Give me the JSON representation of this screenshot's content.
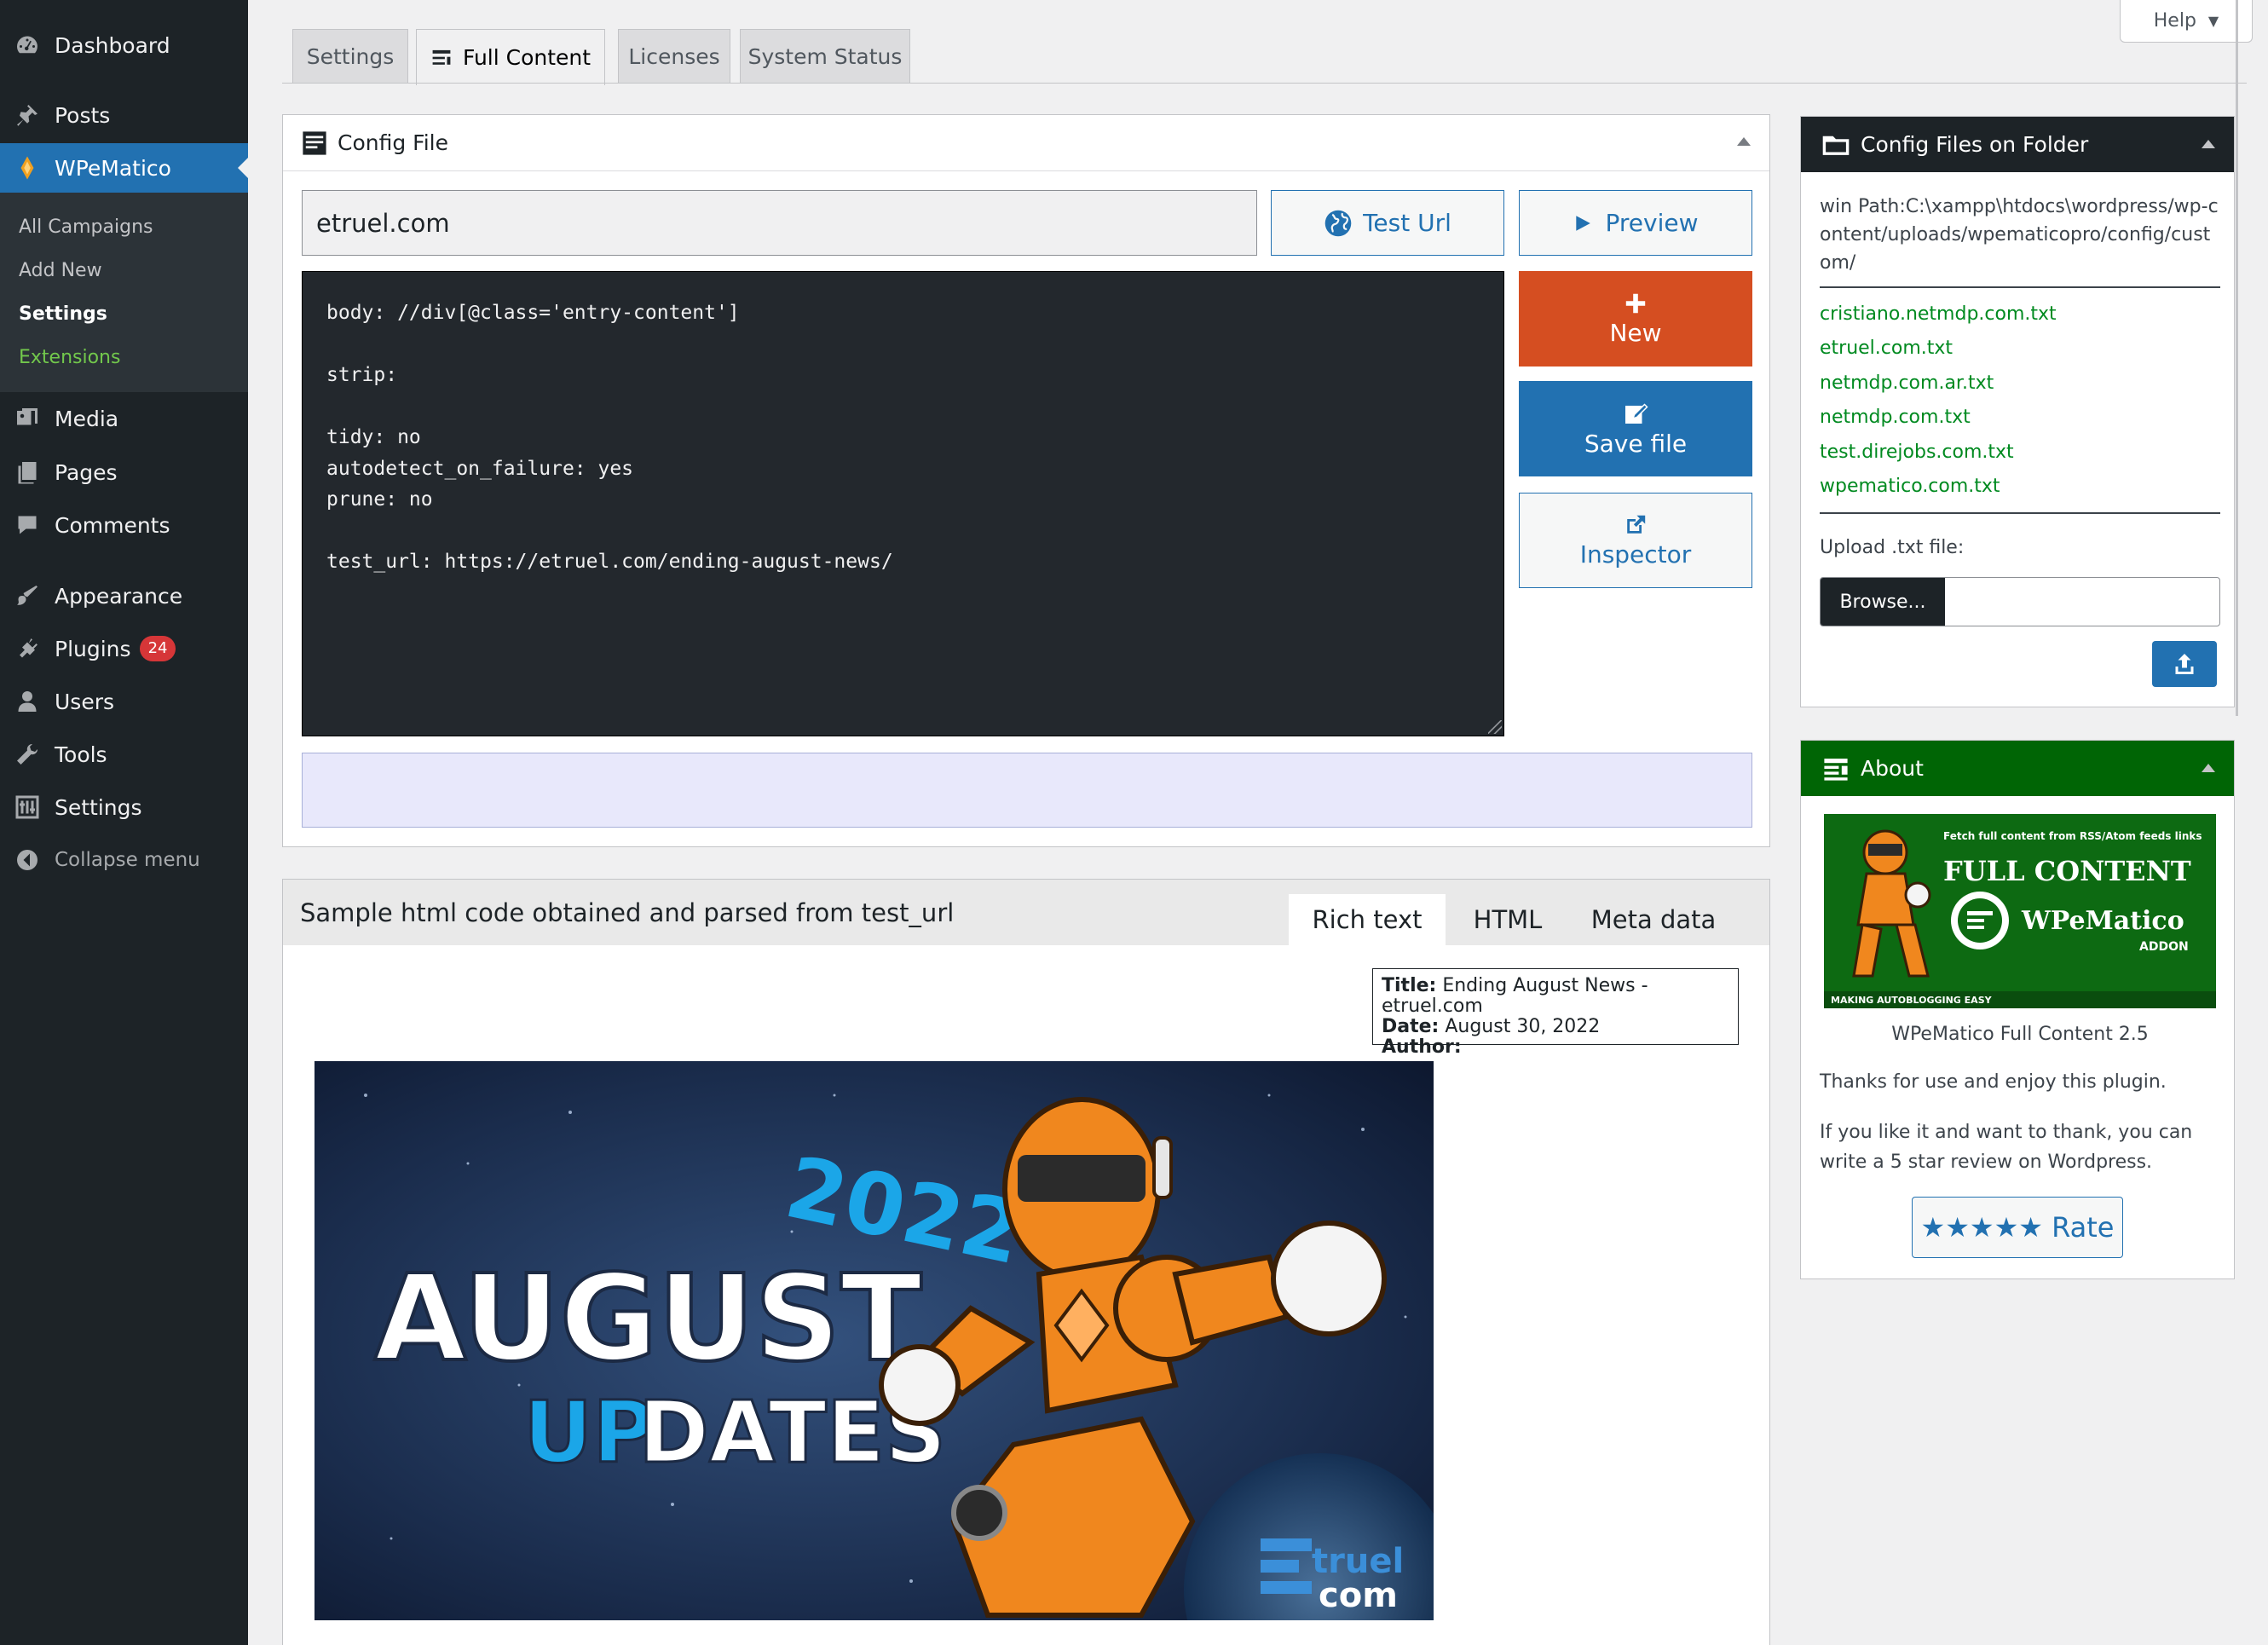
{
  "sidebar": {
    "items": [
      {
        "label": "Dashboard",
        "icon": "dashboard-icon"
      },
      {
        "label": "Posts",
        "icon": "pushpin-icon"
      },
      {
        "label": "WPeMatico",
        "icon": "wpematico-icon"
      },
      {
        "label": "Media",
        "icon": "media-icon"
      },
      {
        "label": "Pages",
        "icon": "pages-icon"
      },
      {
        "label": "Comments",
        "icon": "comments-icon"
      },
      {
        "label": "Appearance",
        "icon": "paintbrush-icon"
      },
      {
        "label": "Plugins",
        "icon": "plugins-icon",
        "badge": "24"
      },
      {
        "label": "Users",
        "icon": "users-icon"
      },
      {
        "label": "Tools",
        "icon": "tools-icon"
      },
      {
        "label": "Settings",
        "icon": "settings-icon"
      },
      {
        "label": "Collapse menu",
        "icon": "collapse-icon"
      }
    ],
    "submenu": [
      "All Campaigns",
      "Add New",
      "Settings",
      "Extensions"
    ]
  },
  "help": {
    "label": "Help"
  },
  "tabs": [
    "Settings",
    "Full Content",
    "Licenses",
    "System Status"
  ],
  "config": {
    "title": "Config File",
    "url": "etruel.com",
    "test_url_label": "Test Url",
    "preview_label": "Preview",
    "new_label": "New",
    "save_label": "Save file",
    "inspector_label": "Inspector",
    "code": "body: //div[@class='entry-content']\n\nstrip:\n\ntidy: no\nautodetect_on_failure: yes\nprune: no\n\ntest_url: https://etruel.com/ending-august-news/"
  },
  "sample": {
    "title": "Sample html code obtained and parsed from test_url",
    "tabs": [
      "Rich text",
      "HTML",
      "Meta data"
    ],
    "meta": {
      "title_label": "Title:",
      "title_value": "Ending August News - etruel.com",
      "date_label": "Date:",
      "date_value": "August 30, 2022",
      "author_label": "Author:"
    },
    "banner": {
      "year": "2022",
      "line1": "AUGUST",
      "line2a": "UP",
      "line2b": "DATES",
      "logo_top": "truel",
      "logo_bottom": "com"
    }
  },
  "folder": {
    "title": "Config Files on Folder",
    "path": "win Path:C:\\xampp\\htdocs\\wordpress/wp-content/uploads/wpematicopro/config/custom/",
    "files": [
      "cristiano.netmdp.com.txt",
      "etruel.com.txt",
      "netmdp.com.ar.txt",
      "netmdp.com.txt",
      "test.direjobs.com.txt",
      "wpematico.com.txt"
    ],
    "upload_label": "Upload .txt file:",
    "browse_label": "Browse..."
  },
  "about": {
    "title": "About",
    "logo_tagline": "Fetch full content from RSS/Atom feeds links",
    "logo_line1": "FULL CONTENT",
    "logo_line2": "WPeMatico",
    "logo_addon": "ADDON",
    "logo_bottom": "MAKING AUTOBLOGGING EASY",
    "version": "WPeMatico Full Content 2.5",
    "thanks": "Thanks for use and enjoy this plugin.",
    "review_line1": "If you like it and want to thank, you can",
    "review_line2": "write a 5 star review on Wordpress.",
    "rate_label": "★★★★★ Rate"
  },
  "colors": {
    "sidebar_bg": "#1d2327",
    "accent": "#2271b1",
    "new_button": "#d54e21",
    "save_button": "#2271b1",
    "about_header": "#006505",
    "folder_header": "#1d2327",
    "file_link": "#008a20"
  }
}
